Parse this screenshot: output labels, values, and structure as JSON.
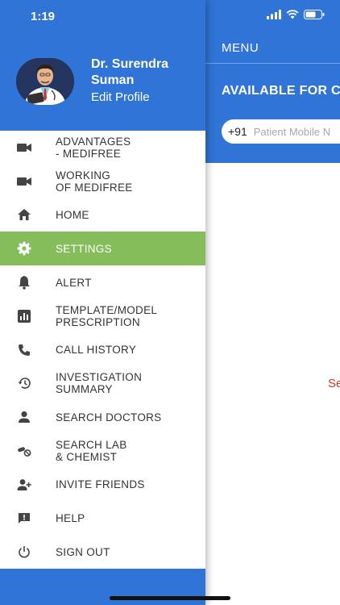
{
  "status_bar": {
    "time": "1:19"
  },
  "profile": {
    "name": "Dr. Surendra Suman",
    "edit_label": "Edit Profile"
  },
  "menu_items": [
    {
      "label": "ADVANTAGES\n- MEDIFREE",
      "icon": "video-camera-icon"
    },
    {
      "label": "WORKING\nOF MEDIFREE",
      "icon": "video-camera-icon"
    },
    {
      "label": "HOME",
      "icon": "home-icon"
    },
    {
      "label": "SETTINGS",
      "icon": "gear-icon",
      "active": true
    },
    {
      "label": "ALERT",
      "icon": "bell-icon"
    },
    {
      "label": "TEMPLATE/MODEL\nPRESCRIPTION",
      "icon": "chart-icon"
    },
    {
      "label": "CALL HISTORY",
      "icon": "phone-icon"
    },
    {
      "label": "INVESTIGATION\nSUMMARY",
      "icon": "history-icon"
    },
    {
      "label": "SEARCH DOCTORS",
      "icon": "person-icon"
    },
    {
      "label": "SEARCH LAB\n& CHEMIST",
      "icon": "pills-icon"
    },
    {
      "label": "INVITE FRIENDS",
      "icon": "person-add-icon"
    },
    {
      "label": "HELP",
      "icon": "feedback-icon"
    },
    {
      "label": "SIGN OUT",
      "icon": "power-icon"
    }
  ],
  "main": {
    "menu_label": "MENU",
    "available_label": "AVAILABLE FOR C",
    "phone_code": "+91",
    "phone_placeholder": "Patient Mobile N",
    "red_text": "Se"
  },
  "colors": {
    "primary": "#2f74d6",
    "active": "#86bd5b",
    "error": "#d93025"
  }
}
